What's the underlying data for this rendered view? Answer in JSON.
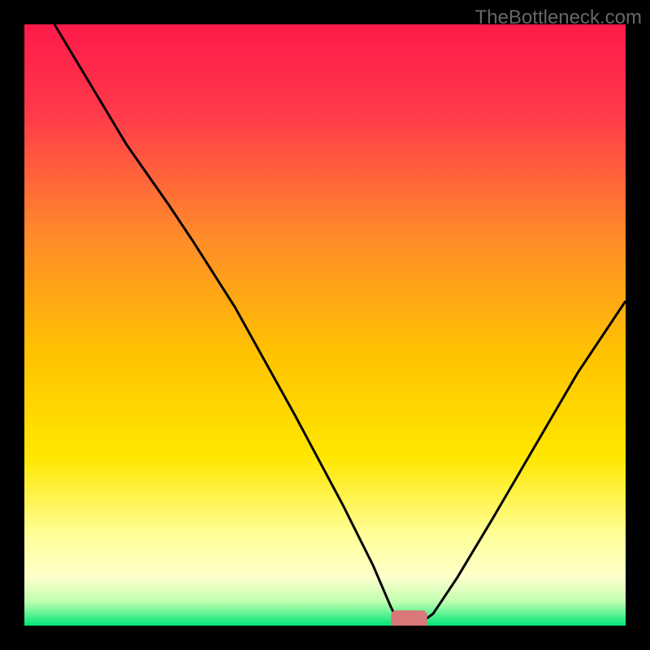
{
  "watermark": "TheBottleneck.com",
  "chart_data": {
    "type": "line",
    "title": "",
    "xlabel": "",
    "ylabel": "",
    "xlim": [
      0,
      100
    ],
    "ylim": [
      0,
      100
    ],
    "gradient_colors": {
      "top": "#ff1a4a",
      "upper_mid": "#ff7a2a",
      "mid": "#ffd700",
      "lower_mid": "#ffff99",
      "bottom": "#00e676"
    },
    "marker": {
      "x": 64,
      "y": 1,
      "color": "#d97878",
      "width": 6,
      "height": 2
    },
    "curve_points": [
      {
        "x": 5,
        "y": 100
      },
      {
        "x": 17,
        "y": 80
      },
      {
        "x": 24,
        "y": 70
      },
      {
        "x": 28,
        "y": 64
      },
      {
        "x": 35,
        "y": 53
      },
      {
        "x": 45,
        "y": 35
      },
      {
        "x": 53,
        "y": 20
      },
      {
        "x": 58,
        "y": 10
      },
      {
        "x": 61,
        "y": 3
      },
      {
        "x": 62,
        "y": 1
      },
      {
        "x": 64,
        "y": 0.5
      },
      {
        "x": 66,
        "y": 0.5
      },
      {
        "x": 68,
        "y": 2
      },
      {
        "x": 72,
        "y": 8
      },
      {
        "x": 78,
        "y": 18
      },
      {
        "x": 85,
        "y": 30
      },
      {
        "x": 92,
        "y": 42
      },
      {
        "x": 100,
        "y": 54
      }
    ]
  }
}
